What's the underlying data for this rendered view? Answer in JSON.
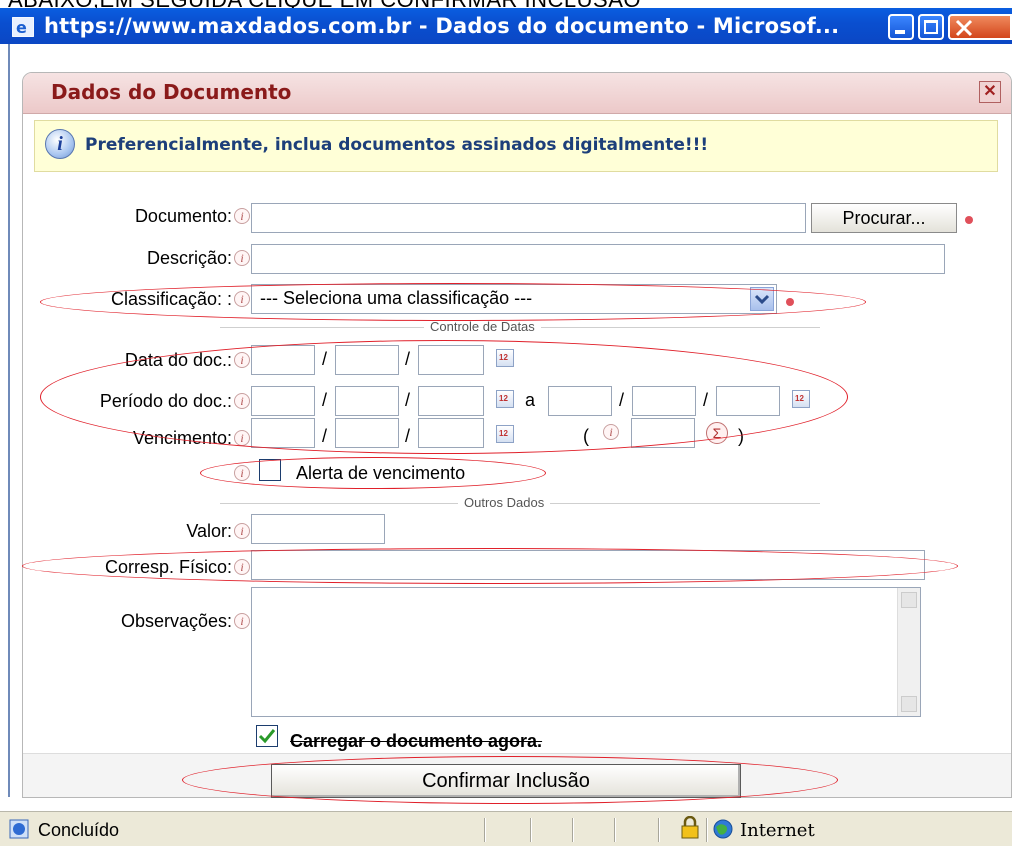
{
  "top_caption": "ABAIXO,EM SEGUIDA CLIQUE  EM CONFIRMAR INCLUSÃO",
  "window": {
    "title": "https://www.maxdados.com.br - Dados do documento - Microsof..."
  },
  "dialog": {
    "title": "Dados do Documento",
    "info_message": "Preferencialmente, inclua documentos assinados digitalmente!!!",
    "fields": {
      "documento_label": "Documento:",
      "browse_button": "Procurar...",
      "descricao_label": "Descrição:",
      "classificacao_label": "Classificação: :",
      "classificacao_value": "--- Seleciona uma classificação ---",
      "section_dates": "Controle de Datas",
      "data_doc_label": "Data do doc.:",
      "periodo_label": "Período do doc.:",
      "periodo_sep": "a",
      "vencimento_label": "Vencimento:",
      "slash": "/",
      "paren_open": "(",
      "paren_close": ")",
      "sigma": "Σ",
      "alerta_label": "Alerta de vencimento",
      "section_other": "Outros Dados",
      "valor_label": "Valor:",
      "corresp_label": "Corresp. Físico:",
      "observacoes_label": "Observações:",
      "carregar_label": "Carregar o documento agora.",
      "confirm_button": "Confirmar Inclusão"
    },
    "carregar_checked": true,
    "alerta_checked": false
  },
  "statusbar": {
    "status": "Concluído",
    "zone": "Internet"
  },
  "colors": {
    "titlebar": "#0a54d6",
    "dialog_header": "#efd3d3",
    "dialog_title": "#8a1a1a",
    "info_bg": "#ffffd7",
    "annotation": "#e0202a"
  }
}
